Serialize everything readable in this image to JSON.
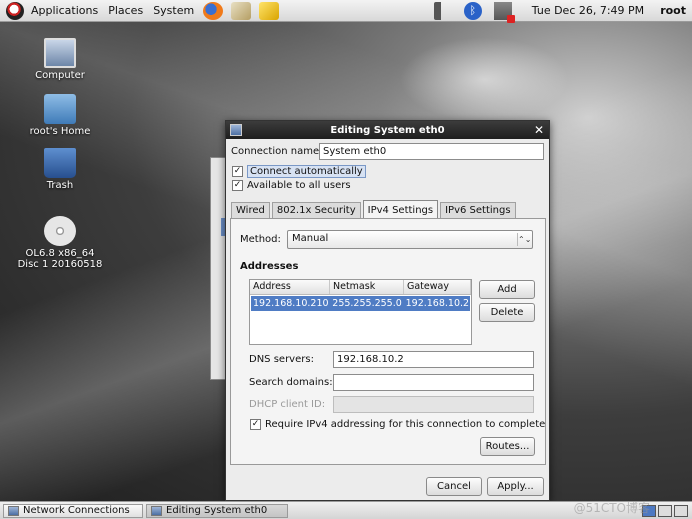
{
  "top_panel": {
    "menus": [
      "Applications",
      "Places",
      "System"
    ],
    "clock": "Tue Dec 26,  7:49 PM",
    "user": "root"
  },
  "desktop": {
    "icons": [
      "Computer",
      "root's Home",
      "Trash",
      "OL6.8 x86_64 Disc 1 20160518"
    ]
  },
  "dialog": {
    "title": "Editing System eth0",
    "connection_name_label": "Connection name:",
    "connection_name_value": "System eth0",
    "connect_automatically": "Connect automatically",
    "available_all_users": "Available to all users",
    "tabs": [
      "Wired",
      "802.1x Security",
      "IPv4 Settings",
      "IPv6 Settings"
    ],
    "active_tab": "IPv4 Settings",
    "method_label": "Method:",
    "method_value": "Manual",
    "addresses_title": "Addresses",
    "table": {
      "columns": [
        "Address",
        "Netmask",
        "Gateway"
      ],
      "rows": [
        [
          "192.168.10.210",
          "255.255.255.0",
          "192.168.10.2"
        ]
      ]
    },
    "add_button": "Add",
    "delete_button": "Delete",
    "dns_label": "DNS servers:",
    "dns_value": "192.168.10.2",
    "search_domains_label": "Search domains:",
    "dhcp_client_id_label": "DHCP client ID:",
    "require_ipv4": "Require IPv4 addressing for this connection to complete",
    "routes_button": "Routes...",
    "cancel_button": "Cancel",
    "apply_button": "Apply..."
  },
  "taskbar": {
    "items": [
      "Network Connections",
      "Editing System eth0"
    ]
  },
  "watermark": "@51CTO博客"
}
